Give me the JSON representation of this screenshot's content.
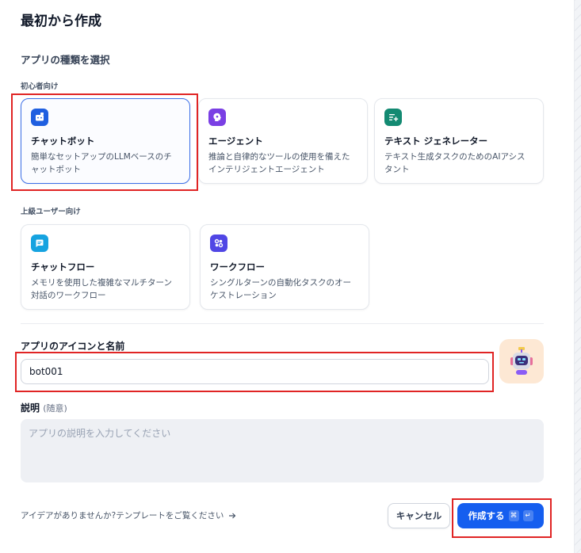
{
  "title": "最初から作成",
  "section_label": "アプリの種類を選択",
  "groups": {
    "beginner": "初心者向け",
    "advanced": "上級ユーザー向け"
  },
  "cards": {
    "chatbot": {
      "name": "チャットボット",
      "desc": "簡単なセットアップのLLMベースのチャットボット",
      "icon": "chatbot-icon",
      "color": "#1f5fe0"
    },
    "agent": {
      "name": "エージェント",
      "desc": "推論と自律的なツールの使用を備えたインテリジェントエージェント",
      "icon": "agent-icon",
      "color": "#7a3fe4"
    },
    "textgen": {
      "name": "テキスト ジェネレーター",
      "desc": "テキスト生成タスクのためのAIアシスタント",
      "icon": "text-generator-icon",
      "color": "#138a72"
    },
    "chatflow": {
      "name": "チャットフロー",
      "desc": "メモリを使用した複雑なマルチターン対話のワークフロー",
      "icon": "chatflow-icon",
      "color": "#16a3e0"
    },
    "workflow": {
      "name": "ワークフロー",
      "desc": "シングルターンの自動化タスクのオーケストレーション",
      "icon": "workflow-icon",
      "color": "#5046e5"
    }
  },
  "name_field": {
    "label": "アプリのアイコンと名前",
    "value": "bot001"
  },
  "description": {
    "label": "説明",
    "optional": "(随意)",
    "placeholder": "アプリの説明を入力してください"
  },
  "footer": {
    "idea_link": "アイデアがありませんか?テンプレートをご覧ください",
    "cancel": "キャンセル",
    "create": "作成する",
    "shortcut_cmd": "⌘",
    "shortcut_enter": "↵"
  }
}
